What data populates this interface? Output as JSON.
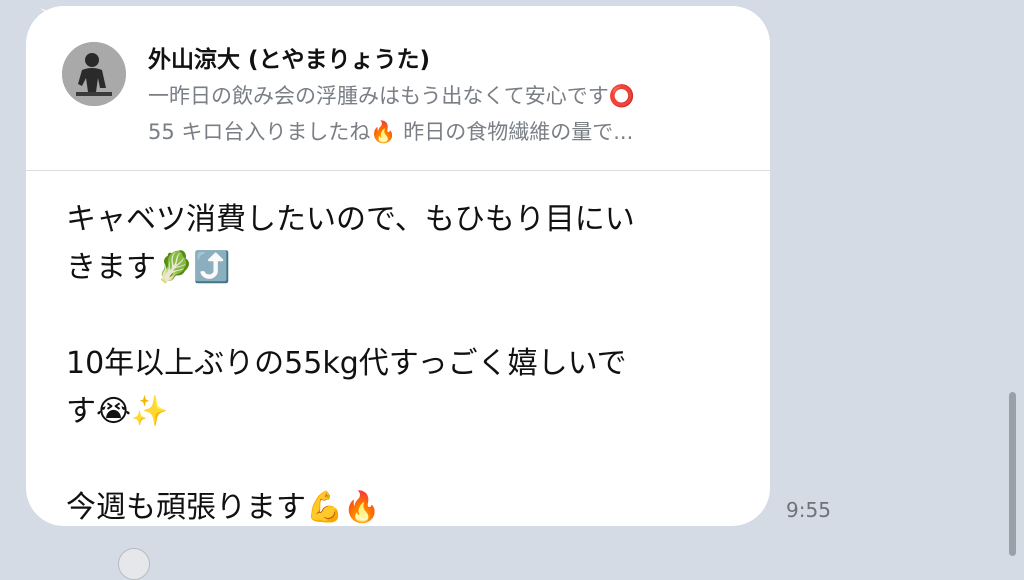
{
  "quoted_message": {
    "sender_name": "外山涼大 (とやまりょうた)",
    "preview_line1": "一昨日の飲み会の浮腫みはもう出なくて安心です⭕",
    "preview_line2": "55 キロ台入りましたね🔥 昨日の食物繊維の量で..."
  },
  "message": {
    "paragraph1": "キャベツ消費したいので、もひもり目にい\nきます🥬⤴️",
    "paragraph2": "10年以上ぶりの55kg代すっごく嬉しいで\nす😭✨",
    "paragraph3": "今週も頑張ります💪🔥"
  },
  "timestamp": "9:55",
  "colors": {
    "background": "#d4dbe4",
    "bubble": "#ffffff",
    "quote_text": "#7a7f86",
    "timestamp": "#6e7279"
  },
  "icons": [
    "avatar-photo",
    "leafy-green-emoji",
    "arrow-up-emoji",
    "crying-face-emoji",
    "sparkles-emoji",
    "flexed-biceps-emoji",
    "fire-emoji",
    "red-circle-emoji"
  ]
}
